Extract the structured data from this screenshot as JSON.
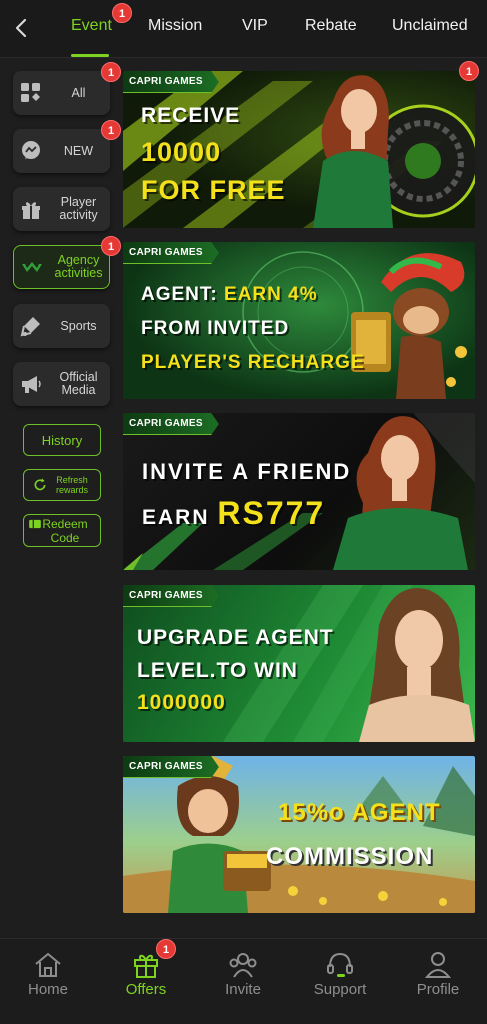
{
  "top_tabs": [
    {
      "label": "Event",
      "active": true,
      "badge": "1"
    },
    {
      "label": "Mission"
    },
    {
      "label": "VIP"
    },
    {
      "label": "Rebate"
    },
    {
      "label": "Unclaimed"
    }
  ],
  "sidebar": {
    "items": [
      {
        "label": "All",
        "icon": "grid-icon",
        "badge": "1"
      },
      {
        "label": "NEW",
        "icon": "chat-bubble-icon",
        "badge": "1"
      },
      {
        "label": "Player activity",
        "icon": "gift-icon"
      },
      {
        "label": "Agency activities",
        "icon": "agency-icon",
        "badge": "1",
        "active": true
      },
      {
        "label": "Sports",
        "icon": "sports-icon"
      },
      {
        "label": "Official Media",
        "icon": "megaphone-icon"
      }
    ],
    "history_label": "History",
    "refresh_label": "Refresh rewards",
    "redeem_label": "Redeem Code"
  },
  "banners": [
    {
      "brand": "CAPRI GAMES",
      "lines": [
        "RECEIVE",
        "10000",
        "FOR FREE"
      ],
      "badge": "1"
    },
    {
      "brand": "CAPRI GAMES",
      "line1_a": "AGENT:",
      "line1_b": "EARN 4%",
      "line2": "FROM INVITED",
      "line3": "PLAYER'S RECHARGE"
    },
    {
      "brand": "CAPRI GAMES",
      "line1": "INVITE A FRIEND",
      "line2_a": "EARN",
      "line2_b": "RS777"
    },
    {
      "brand": "CAPRI GAMES",
      "lines": [
        "UPGRADE AGENT",
        "LEVEL.TO WIN",
        "1000000"
      ]
    },
    {
      "brand": "CAPRI GAMES",
      "lines": [
        "15%o AGENT",
        "COMMISSION"
      ]
    }
  ],
  "bottom_nav": [
    {
      "label": "Home",
      "icon": "home-icon"
    },
    {
      "label": "Offers",
      "icon": "gift-icon",
      "active": true,
      "badge": "1"
    },
    {
      "label": "Invite",
      "icon": "invite-icon"
    },
    {
      "label": "Support",
      "icon": "headset-icon"
    },
    {
      "label": "Profile",
      "icon": "profile-icon"
    }
  ],
  "colors": {
    "accent": "#7ed321",
    "background": "#1e1e1e",
    "badge": "#e53935",
    "yellow_text": "#f5e11b"
  }
}
